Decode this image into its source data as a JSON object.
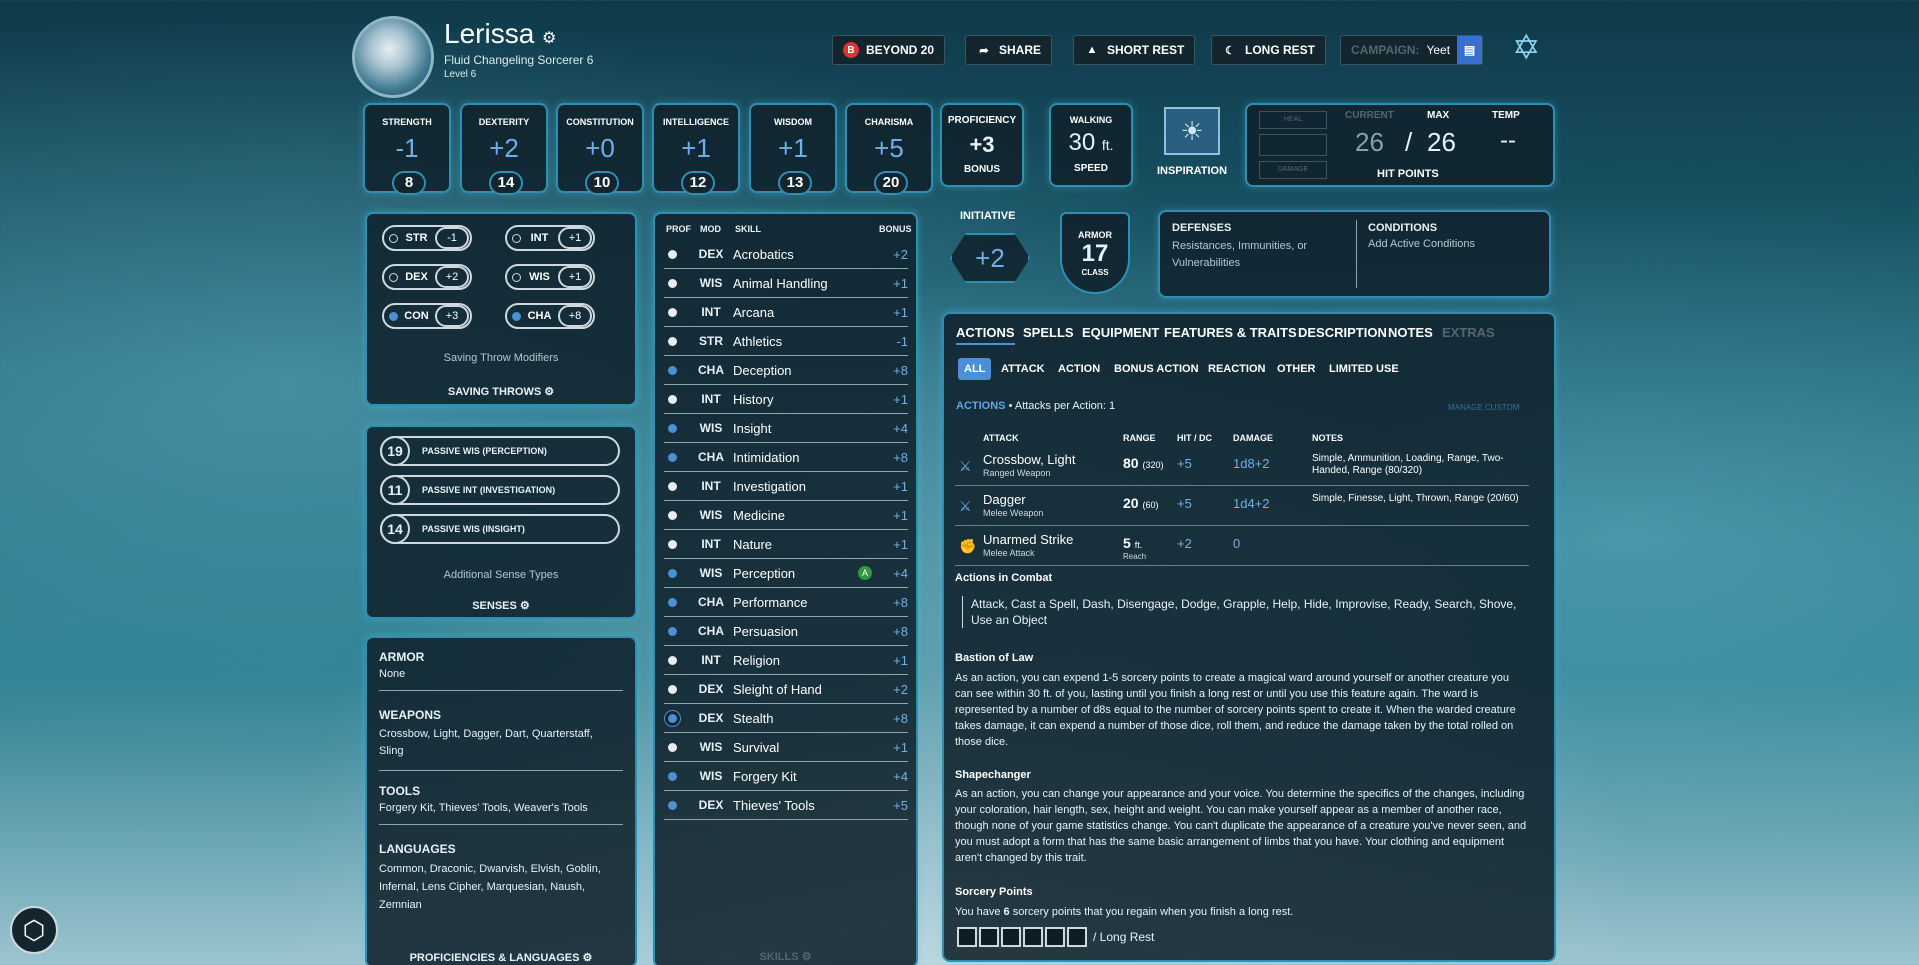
{
  "character": {
    "name": "Lerissa",
    "subtitle": "Fluid  Changeling  Sorcerer 6",
    "level": "Level 6"
  },
  "header_buttons": {
    "beyond20": "BEYOND 20",
    "share": "SHARE",
    "short_rest": "SHORT REST",
    "long_rest": "LONG REST",
    "campaign_label": "CAMPAIGN:",
    "campaign_name": "Yeet"
  },
  "abilities": [
    {
      "label": "STRENGTH",
      "mod": "-1",
      "score": "8"
    },
    {
      "label": "DEXTERITY",
      "mod": "+2",
      "score": "14"
    },
    {
      "label": "CONSTITUTION",
      "mod": "+0",
      "score": "10"
    },
    {
      "label": "INTELLIGENCE",
      "mod": "+1",
      "score": "12"
    },
    {
      "label": "WISDOM",
      "mod": "+1",
      "score": "13"
    },
    {
      "label": "CHARISMA",
      "mod": "+5",
      "score": "20"
    }
  ],
  "proficiency": {
    "label": "PROFICIENCY",
    "value": "+3",
    "sub": "BONUS"
  },
  "speed": {
    "label": "WALKING",
    "value": "30",
    "unit": "ft.",
    "sub": "SPEED"
  },
  "inspiration": {
    "label": "INSPIRATION"
  },
  "hit_points": {
    "heal": "HEAL",
    "damage": "DAMAGE",
    "current_label": "CURRENT",
    "max_label": "MAX",
    "temp_label": "TEMP",
    "current": "26",
    "sep": "/",
    "max": "26",
    "temp": "--",
    "title": "HIT POINTS"
  },
  "saving_throws": {
    "items": [
      {
        "name": "STR",
        "bonus": "-1",
        "prof": false
      },
      {
        "name": "INT",
        "bonus": "+1",
        "prof": false
      },
      {
        "name": "DEX",
        "bonus": "+2",
        "prof": false
      },
      {
        "name": "WIS",
        "bonus": "+1",
        "prof": false
      },
      {
        "name": "CON",
        "bonus": "+3",
        "prof": true
      },
      {
        "name": "CHA",
        "bonus": "+8",
        "prof": true
      }
    ],
    "modifiers_label": "Saving Throw Modifiers",
    "title": "SAVING THROWS"
  },
  "senses": {
    "items": [
      {
        "value": "19",
        "label": "PASSIVE WIS (PERCEPTION)"
      },
      {
        "value": "11",
        "label": "PASSIVE INT (INVESTIGATION)"
      },
      {
        "value": "14",
        "label": "PASSIVE WIS (INSIGHT)"
      }
    ],
    "additional": "Additional Sense Types",
    "title": "SENSES"
  },
  "proficiencies": {
    "armor_title": "ARMOR",
    "armor": "None",
    "weapons_title": "WEAPONS",
    "weapons": "Crossbow, Light, Dagger, Dart, Quarterstaff, Sling",
    "tools_title": "TOOLS",
    "tools": "Forgery Kit, Thieves' Tools, Weaver's Tools",
    "languages_title": "LANGUAGES",
    "languages": "Common, Draconic, Dwarvish, Elvish, Goblin, Infernal, Lens Cipher, Marquesian, Naush, Zemnian",
    "title": "PROFICIENCIES & LANGUAGES"
  },
  "skills": {
    "headers": {
      "prof": "PROF",
      "mod": "MOD",
      "skill": "SKILL",
      "bonus": "BONUS"
    },
    "items": [
      {
        "prof": "none",
        "mod": "DEX",
        "name": "Acrobatics",
        "bonus": "+2"
      },
      {
        "prof": "none",
        "mod": "WIS",
        "name": "Animal Handling",
        "bonus": "+1"
      },
      {
        "prof": "none",
        "mod": "INT",
        "name": "Arcana",
        "bonus": "+1"
      },
      {
        "prof": "none",
        "mod": "STR",
        "name": "Athletics",
        "bonus": "-1"
      },
      {
        "prof": "prof",
        "mod": "CHA",
        "name": "Deception",
        "bonus": "+8"
      },
      {
        "prof": "none",
        "mod": "INT",
        "name": "History",
        "bonus": "+1"
      },
      {
        "prof": "prof",
        "mod": "WIS",
        "name": "Insight",
        "bonus": "+4"
      },
      {
        "prof": "prof",
        "mod": "CHA",
        "name": "Intimidation",
        "bonus": "+8"
      },
      {
        "prof": "none",
        "mod": "INT",
        "name": "Investigation",
        "bonus": "+1"
      },
      {
        "prof": "none",
        "mod": "WIS",
        "name": "Medicine",
        "bonus": "+1"
      },
      {
        "prof": "none",
        "mod": "INT",
        "name": "Nature",
        "bonus": "+1"
      },
      {
        "prof": "prof",
        "mod": "WIS",
        "name": "Perception",
        "bonus": "+4",
        "adv": "A"
      },
      {
        "prof": "prof",
        "mod": "CHA",
        "name": "Performance",
        "bonus": "+8"
      },
      {
        "prof": "prof",
        "mod": "CHA",
        "name": "Persuasion",
        "bonus": "+8"
      },
      {
        "prof": "none",
        "mod": "INT",
        "name": "Religion",
        "bonus": "+1"
      },
      {
        "prof": "none",
        "mod": "DEX",
        "name": "Sleight of Hand",
        "bonus": "+2"
      },
      {
        "prof": "exp",
        "mod": "DEX",
        "name": "Stealth",
        "bonus": "+8"
      },
      {
        "prof": "none",
        "mod": "WIS",
        "name": "Survival",
        "bonus": "+1"
      },
      {
        "prof": "prof",
        "mod": "WIS",
        "name": "Forgery Kit",
        "bonus": "+4"
      },
      {
        "prof": "prof",
        "mod": "DEX",
        "name": "Thieves' Tools",
        "bonus": "+5"
      }
    ],
    "title": "SKILLS"
  },
  "initiative": {
    "label": "INITIATIVE",
    "value": "+2"
  },
  "armor_class": {
    "label": "ARMOR",
    "value": "17",
    "sub": "CLASS"
  },
  "defenses": {
    "title": "DEFENSES",
    "text": "Resistances, Immunities, or Vulnerabilities"
  },
  "conditions": {
    "title": "CONDITIONS",
    "text": "Add Active Conditions"
  },
  "tabs": [
    "ACTIONS",
    "SPELLS",
    "EQUIPMENT",
    "FEATURES & TRAITS",
    "DESCRIPTION",
    "NOTES",
    "EXTRAS"
  ],
  "subtabs": [
    "ALL",
    "ATTACK",
    "ACTION",
    "BONUS ACTION",
    "REACTION",
    "OTHER",
    "LIMITED USE"
  ],
  "actions": {
    "title": "ACTIONS",
    "attacks_per_action": "• Attacks per Action: 1",
    "manage": "MANAGE CUSTOM",
    "headers": {
      "attack": "ATTACK",
      "range": "RANGE",
      "hit": "HIT / DC",
      "damage": "DAMAGE",
      "notes": "NOTES"
    },
    "attacks": [
      {
        "name": "Crossbow, Light",
        "sub": "Ranged Weapon",
        "range": "80",
        "range_long": "(320)",
        "range_sub": "",
        "hit": "+5",
        "damage": "1d8+2",
        "notes": "Simple, Ammunition, Loading, Range, Two-Handed, Range (80/320)"
      },
      {
        "name": "Dagger",
        "sub": "Melee Weapon",
        "range": "20",
        "range_long": "(60)",
        "range_sub": "",
        "hit": "+5",
        "damage": "1d4+2",
        "notes": "Simple, Finesse, Light, Thrown, Range (20/60)"
      },
      {
        "name": "Unarmed Strike",
        "sub": "Melee Attack",
        "range": "5",
        "range_long": "ft.",
        "range_sub": "Reach",
        "hit": "+2",
        "damage": "0",
        "notes": ""
      }
    ],
    "combat_title": "Actions in Combat",
    "combat_text": "Attack, Cast a Spell, Dash, Disengage, Dodge, Grapple, Help, Hide, Improvise, Ready, Search, Shove, Use an Object",
    "bastion_title": "Bastion of Law",
    "bastion_text": "As an action, you can expend 1-5 sorcery points to create a magical ward around yourself or another creature you can see within 30 ft. of you, lasting until you finish a long rest or until you use this feature again. The ward is represented by a number of d8s equal to the number of sorcery points spent to create it. When the warded creature takes damage, it can expend a number of those dice, roll them, and reduce the damage taken by the total rolled on those dice.",
    "shape_title": "Shapechanger",
    "shape_text": "As an action, you can change your appearance and your voice. You determine the specifics of the changes, including your coloration, hair length, sex, height and weight. You can make yourself appear as a member of another race, though none of your game statistics change. You can't duplicate the appearance of a creature you've never seen, and you must adopt a form that has the same basic arrangement of limbs that you have. Your clothing and equipment aren't changed by this trait.",
    "sorcery_title": "Sorcery Points",
    "sorcery_text_pre": "You have ",
    "sorcery_count": "6",
    "sorcery_text_post": " sorcery points that you regain when you finish a long rest.",
    "sorcery_boxes": 6,
    "sorcery_reset": "/ Long Rest"
  }
}
